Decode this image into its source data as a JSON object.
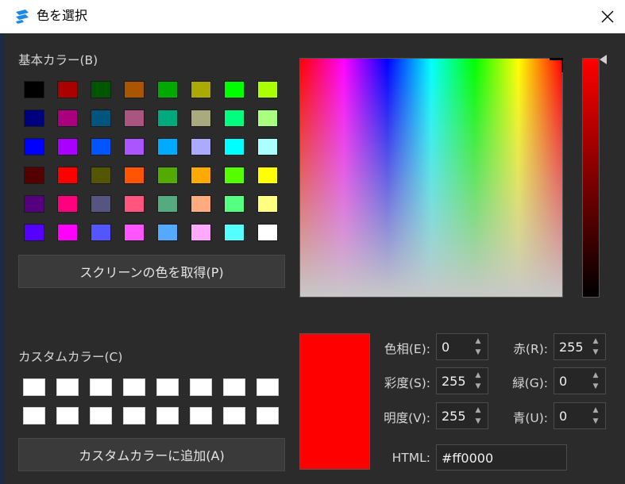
{
  "window": {
    "title": "色を選択",
    "icon": "app-logo-icon",
    "accent_color": "#1e88e5"
  },
  "basic_colors": {
    "label": "基本カラー(B)",
    "rows": [
      [
        "#000000",
        "#aa0000",
        "#005500",
        "#aa5500",
        "#00aa00",
        "#aaaa00",
        "#00ff00",
        "#aaff00"
      ],
      [
        "#00007f",
        "#aa007f",
        "#00557f",
        "#aa557f",
        "#00aa7f",
        "#aaaa7f",
        "#00ff7f",
        "#aaff7f"
      ],
      [
        "#0000ff",
        "#aa00ff",
        "#0055ff",
        "#aa55ff",
        "#00aaff",
        "#aaaaff",
        "#00ffff",
        "#aaffff"
      ],
      [
        "#550000",
        "#ff0000",
        "#555500",
        "#ff5500",
        "#55aa00",
        "#ffaa00",
        "#55ff00",
        "#ffff00"
      ],
      [
        "#55007f",
        "#ff007f",
        "#55557f",
        "#ff557f",
        "#55aa7f",
        "#ffaa7f",
        "#55ff7f",
        "#ffff7f"
      ],
      [
        "#5500ff",
        "#ff00ff",
        "#5555ff",
        "#ff55ff",
        "#55aaff",
        "#ffaaff",
        "#55ffff",
        "#ffffff"
      ]
    ]
  },
  "pick_screen_button": "スクリーンの色を取得(P)",
  "custom_colors": {
    "label": "カスタムカラー(C)",
    "rows": [
      [
        "#ffffff",
        "#ffffff",
        "#ffffff",
        "#ffffff",
        "#ffffff",
        "#ffffff",
        "#ffffff",
        "#ffffff"
      ],
      [
        "#ffffff",
        "#ffffff",
        "#ffffff",
        "#ffffff",
        "#ffffff",
        "#ffffff",
        "#ffffff",
        "#ffffff"
      ]
    ]
  },
  "add_custom_button": "カスタムカラーに追加(A)",
  "current_color": "#ff0000",
  "fields": {
    "hue": {
      "label": "色相(E):",
      "value": "0"
    },
    "saturation": {
      "label": "彩度(S):",
      "value": "255"
    },
    "value": {
      "label": "明度(V):",
      "value": "255"
    },
    "red": {
      "label": "赤(R):",
      "value": "255"
    },
    "green": {
      "label": "緑(G):",
      "value": "0"
    },
    "blue": {
      "label": "青(U):",
      "value": "0"
    }
  },
  "html": {
    "label": "HTML:",
    "value": "#ff0000"
  }
}
